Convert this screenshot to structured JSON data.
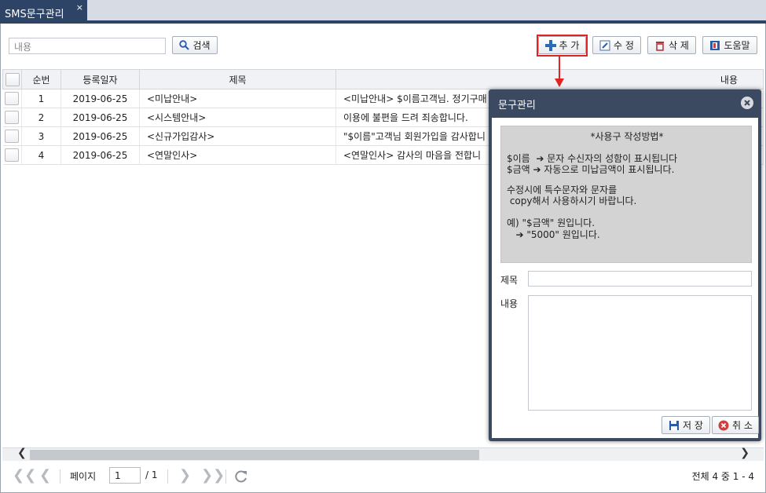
{
  "tab": {
    "title": "SMS문구관리",
    "close": "×"
  },
  "toolbar": {
    "search_placeholder": "내용",
    "search_label": "검색",
    "add_label": "추 가",
    "edit_label": "수 정",
    "delete_label": "삭 제",
    "help_label": "도움말"
  },
  "table": {
    "headers": [
      "순번",
      "등록일자",
      "제목",
      "내용"
    ],
    "rows": [
      {
        "no": "1",
        "date": "2019-06-25",
        "title": "<미납안내>",
        "content": "<미납안내> $이름고객님. 정기구매"
      },
      {
        "no": "2",
        "date": "2019-06-25",
        "title": "<시스템안내>",
        "content": "이용에 불편을 드려 죄송합니다."
      },
      {
        "no": "3",
        "date": "2019-06-25",
        "title": "<신규가입감사>",
        "content": "\"$이름\"고객님 회원가입을 감사합니"
      },
      {
        "no": "4",
        "date": "2019-06-25",
        "title": "<연말인사>",
        "content": "<연말인사> 감사의 마음을 전합니"
      }
    ]
  },
  "pager": {
    "page_label": "페이지",
    "page_value": "1",
    "page_total": "/ 1",
    "summary": "전체 4 중 1 - 4"
  },
  "dialog": {
    "title": "문구관리",
    "guide": {
      "heading": "*사용구 작성방법*",
      "line1": "$이름  ➔ 문자 수신자의 성함이 표시됩니다",
      "line2": "$금액 ➔ 자동으로 미납금액이 표시됩니다.",
      "line3": "수정시에 특수문자와 문자를",
      "line4": " copy해서 사용하시기 바랍니다.",
      "line5": "예) \"$금액\" 원입니다.",
      "line6": "   ➔ \"5000\" 원입니다."
    },
    "title_label": "제목",
    "content_label": "내용",
    "save_label": "저 장",
    "cancel_label": "취 소"
  },
  "colors": {
    "accent": "#2d4467",
    "highlight": "#e02424",
    "dialog_header": "#3b4a60"
  }
}
